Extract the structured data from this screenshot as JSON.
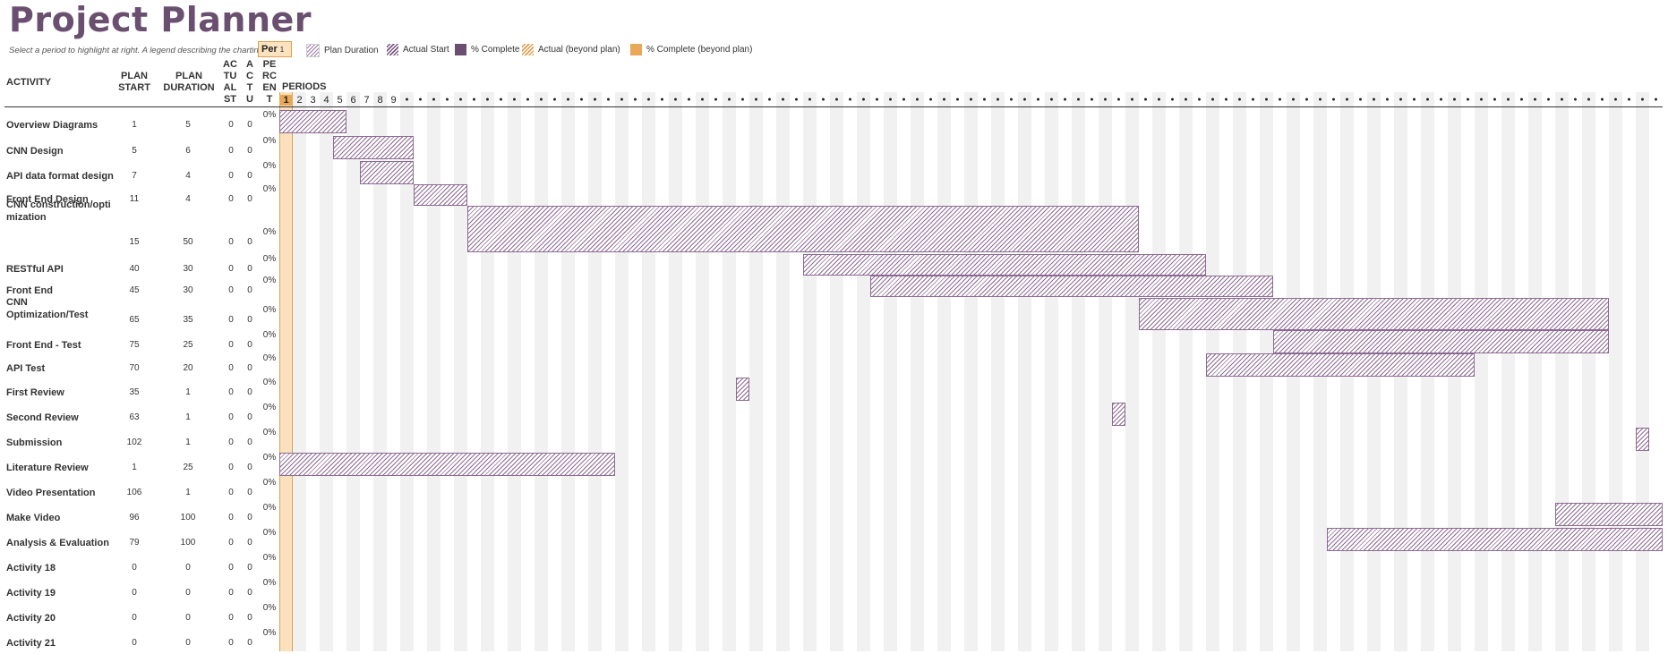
{
  "title": "Project Planner",
  "hint": "Select a period to highlight at right.  A legend describing the charting follows.",
  "period_selector": {
    "label": "Per",
    "value": "1"
  },
  "legend": [
    {
      "label": "Plan Duration",
      "swatch": "sw-plan"
    },
    {
      "label": "Actual Start",
      "swatch": "sw-actual"
    },
    {
      "label": "% Complete",
      "swatch": "sw-complete"
    },
    {
      "label": "Actual (beyond plan)",
      "swatch": "sw-beyond"
    },
    {
      "label": "% Complete (beyond plan)",
      "swatch": "sw-cbeyond"
    }
  ],
  "headers": {
    "activity": "ACTIVITY",
    "plan_start": "PLAN START",
    "plan_duration": "PLAN DURATION",
    "actual_start": "AC TU AL ST",
    "actual_duration": "A C T U",
    "percent": "PE RC EN T",
    "periods": "PERIODS"
  },
  "periods_visible": [
    "1",
    "2",
    "3",
    "4",
    "5",
    "6",
    "7",
    "8",
    "9"
  ],
  "period_count": 103,
  "highlight_period": 1,
  "colors": {
    "accent": "#6b4f70",
    "highlight": "#e8a858",
    "bar": "#8d6a93"
  },
  "activities": [
    {
      "name": "Overview Diagrams",
      "plan_start": 1,
      "plan_duration": 5,
      "actual_start": 0,
      "actual_duration": 0,
      "percent": "0%"
    },
    {
      "name": "CNN Design",
      "plan_start": 5,
      "plan_duration": 6,
      "actual_start": 0,
      "actual_duration": 0,
      "percent": "0%"
    },
    {
      "name": "API data format design",
      "plan_start": 7,
      "plan_duration": 4,
      "actual_start": 0,
      "actual_duration": 0,
      "percent": "0%"
    },
    {
      "name": "Front End Design",
      "plan_start": 11,
      "plan_duration": 4,
      "actual_start": 0,
      "actual_duration": 0,
      "percent": "0%"
    },
    {
      "name": "CNN construction/optimization",
      "plan_start": 15,
      "plan_duration": 50,
      "actual_start": 0,
      "actual_duration": 0,
      "percent": "0%"
    },
    {
      "name": "RESTful API",
      "plan_start": 40,
      "plan_duration": 30,
      "actual_start": 0,
      "actual_duration": 0,
      "percent": "0%"
    },
    {
      "name": "Front End",
      "plan_start": 45,
      "plan_duration": 30,
      "actual_start": 0,
      "actual_duration": 0,
      "percent": "0%"
    },
    {
      "name": "CNN Optimization/Test",
      "plan_start": 65,
      "plan_duration": 35,
      "actual_start": 0,
      "actual_duration": 0,
      "percent": "0%"
    },
    {
      "name": "Front End - Test",
      "plan_start": 75,
      "plan_duration": 25,
      "actual_start": 0,
      "actual_duration": 0,
      "percent": "0%"
    },
    {
      "name": "API Test",
      "plan_start": 70,
      "plan_duration": 20,
      "actual_start": 0,
      "actual_duration": 0,
      "percent": "0%"
    },
    {
      "name": "First Review",
      "plan_start": 35,
      "plan_duration": 1,
      "actual_start": 0,
      "actual_duration": 0,
      "percent": "0%"
    },
    {
      "name": "Second Review",
      "plan_start": 63,
      "plan_duration": 1,
      "actual_start": 0,
      "actual_duration": 0,
      "percent": "0%"
    },
    {
      "name": "Submission",
      "plan_start": 102,
      "plan_duration": 1,
      "actual_start": 0,
      "actual_duration": 0,
      "percent": "0%"
    },
    {
      "name": "Literature Review",
      "plan_start": 1,
      "plan_duration": 25,
      "actual_start": 0,
      "actual_duration": 0,
      "percent": "0%"
    },
    {
      "name": "Video Presentation",
      "plan_start": 106,
      "plan_duration": 1,
      "actual_start": 0,
      "actual_duration": 0,
      "percent": "0%"
    },
    {
      "name": "Make Video",
      "plan_start": 96,
      "plan_duration": 100,
      "actual_start": 0,
      "actual_duration": 0,
      "percent": "0%"
    },
    {
      "name": "Analysis & Evaluation",
      "plan_start": 79,
      "plan_duration": 100,
      "actual_start": 0,
      "actual_duration": 0,
      "percent": "0%"
    },
    {
      "name": "Activity 18",
      "plan_start": 0,
      "plan_duration": 0,
      "actual_start": 0,
      "actual_duration": 0,
      "percent": "0%"
    },
    {
      "name": "Activity 19",
      "plan_start": 0,
      "plan_duration": 0,
      "actual_start": 0,
      "actual_duration": 0,
      "percent": "0%"
    },
    {
      "name": "Activity 20",
      "plan_start": 0,
      "plan_duration": 0,
      "actual_start": 0,
      "actual_duration": 0,
      "percent": "0%"
    },
    {
      "name": "Activity 21",
      "plan_start": 0,
      "plan_duration": 0,
      "actual_start": 0,
      "actual_duration": 0,
      "percent": "0%"
    }
  ]
}
